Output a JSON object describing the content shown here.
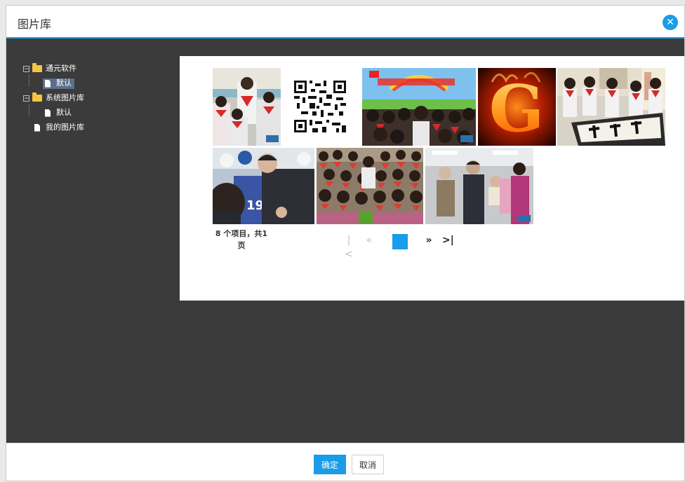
{
  "dialog": {
    "title": "图片库",
    "close_icon": "close-icon",
    "accent_color": "#1a9ce8"
  },
  "tree": {
    "nodes": [
      {
        "label": "通元软件",
        "icon": "folder-open-icon",
        "toggle": "⊟",
        "children": [
          {
            "label": "默认",
            "icon": "file-icon",
            "selected": true
          }
        ]
      },
      {
        "label": "系统图片库",
        "icon": "folder-open-icon",
        "toggle": "⊟",
        "children": [
          {
            "label": "默认",
            "icon": "file-icon",
            "selected": false
          }
        ]
      },
      {
        "label": "我的图片库",
        "icon": "file-icon",
        "selected": false
      }
    ]
  },
  "gallery": {
    "images": [
      {
        "name": "photo-children-red-scarves-1"
      },
      {
        "name": "qr-code-image"
      },
      {
        "name": "photo-banner-children-crowd"
      },
      {
        "name": "image-fire-letter-g"
      },
      {
        "name": "photo-calligraphy-children"
      },
      {
        "name": "photo-hockey-children"
      },
      {
        "name": "photo-children-group-red-scarves"
      },
      {
        "name": "photo-elderly-visit"
      }
    ],
    "pager": {
      "info": "8 个项目，共1 页",
      "first_icon": "first-page-icon",
      "prev_icon": "prev-page-icon",
      "current_page": "1",
      "next_icon": "next-page-icon",
      "last_icon": "last-page-icon"
    }
  },
  "footer": {
    "ok_label": "确定",
    "cancel_label": "取消"
  }
}
